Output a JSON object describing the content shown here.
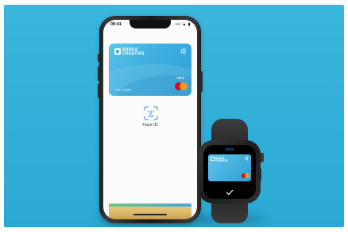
{
  "phone": {
    "status_time": "09:41",
    "status_icons": "••• ▲ ▮",
    "card": {
      "bank_line1": "BANKA",
      "bank_line2": "CREDITAS",
      "contactless": "(((",
      "type": "debit",
      "number": "•••• 1234"
    },
    "faceid_label": "Face ID"
  },
  "watch": {
    "done_label": "Done",
    "card": {
      "bank_line1": "BANKA",
      "bank_line2": "CREDITAS",
      "contactless": "((("
    }
  },
  "colors": {
    "background": "#2aa9d4",
    "card_blue": "#3fb0e0",
    "mastercard_red": "#eb001b",
    "mastercard_yellow": "#f79e1b"
  },
  "icons": [
    "bank-logo-icon",
    "contactless-icon",
    "mastercard-logo-icon",
    "face-id-icon",
    "checkmark-icon"
  ]
}
